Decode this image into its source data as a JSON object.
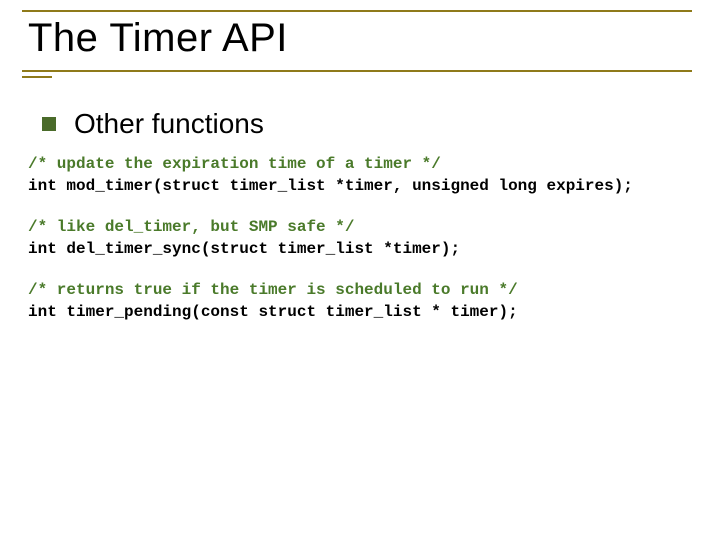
{
  "slide": {
    "title": "The Timer API",
    "bullet": "Other functions",
    "blocks": [
      {
        "comment": "/* update the expiration time of a timer */",
        "decl": "int mod_timer(struct timer_list *timer, unsigned long expires);"
      },
      {
        "comment": "/* like del_timer, but SMP safe */",
        "decl": "int del_timer_sync(struct timer_list *timer);"
      },
      {
        "comment": "/* returns true if the timer is scheduled to run */",
        "decl": "int timer_pending(const struct timer_list * timer);"
      }
    ]
  }
}
